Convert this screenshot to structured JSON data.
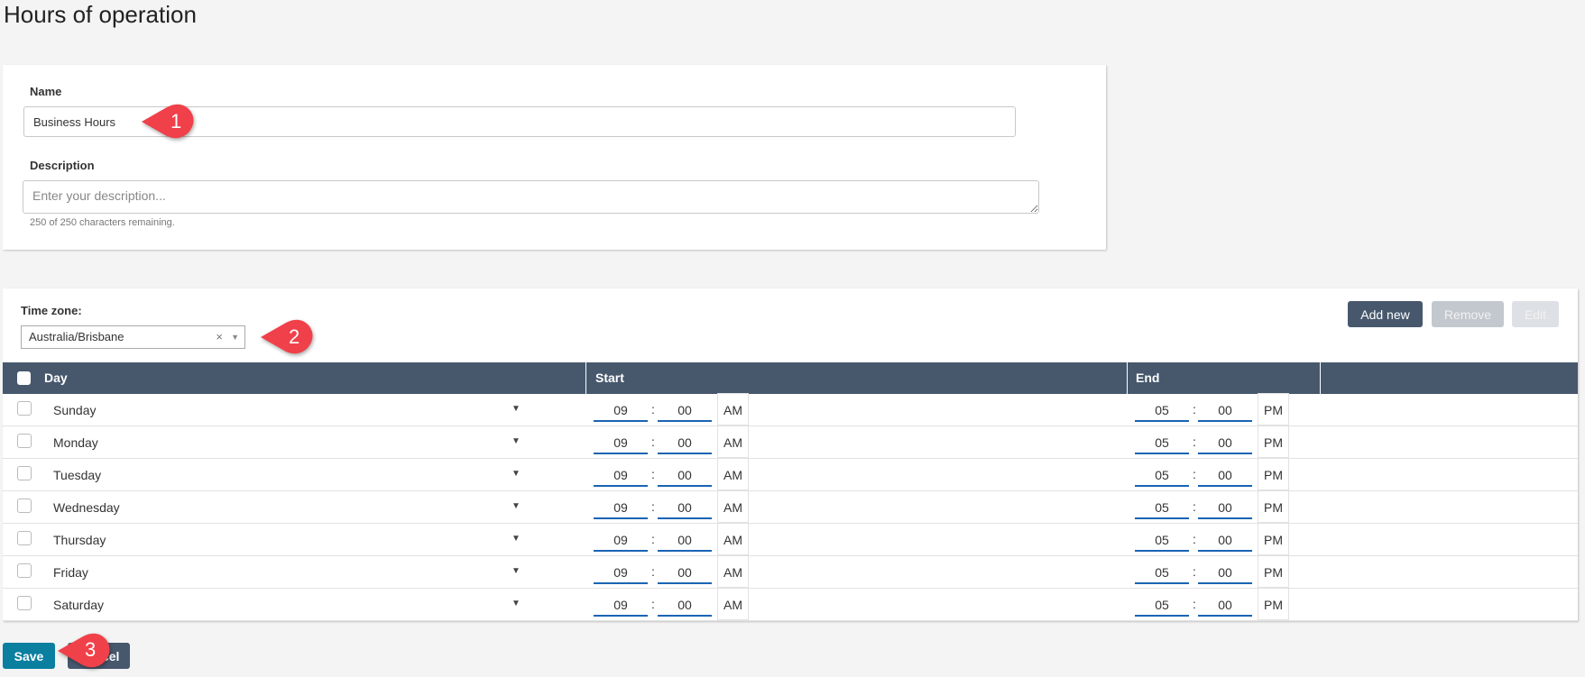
{
  "page": {
    "title": "Hours of operation"
  },
  "form": {
    "name_label": "Name",
    "name_value": "Business Hours",
    "description_label": "Description",
    "description_placeholder": "Enter your description...",
    "description_value": "",
    "char_hint": "250 of 250 characters remaining."
  },
  "timezone": {
    "label": "Time zone:",
    "value": "Australia/Brisbane",
    "clear_glyph": "×",
    "arrow_glyph": "▼"
  },
  "toolbar": {
    "add_label": "Add new",
    "remove_label": "Remove",
    "edit_label": "Edit"
  },
  "table": {
    "headers": {
      "day": "Day",
      "start": "Start",
      "end": "End"
    },
    "rows": [
      {
        "day": "Sunday",
        "start_h": "09",
        "start_m": "00",
        "start_ampm": "AM",
        "end_h": "05",
        "end_m": "00",
        "end_ampm": "PM"
      },
      {
        "day": "Monday",
        "start_h": "09",
        "start_m": "00",
        "start_ampm": "AM",
        "end_h": "05",
        "end_m": "00",
        "end_ampm": "PM"
      },
      {
        "day": "Tuesday",
        "start_h": "09",
        "start_m": "00",
        "start_ampm": "AM",
        "end_h": "05",
        "end_m": "00",
        "end_ampm": "PM"
      },
      {
        "day": "Wednesday",
        "start_h": "09",
        "start_m": "00",
        "start_ampm": "AM",
        "end_h": "05",
        "end_m": "00",
        "end_ampm": "PM"
      },
      {
        "day": "Thursday",
        "start_h": "09",
        "start_m": "00",
        "start_ampm": "AM",
        "end_h": "05",
        "end_m": "00",
        "end_ampm": "PM"
      },
      {
        "day": "Friday",
        "start_h": "09",
        "start_m": "00",
        "start_ampm": "AM",
        "end_h": "05",
        "end_m": "00",
        "end_ampm": "PM"
      },
      {
        "day": "Saturday",
        "start_h": "09",
        "start_m": "00",
        "start_ampm": "AM",
        "end_h": "05",
        "end_m": "00",
        "end_ampm": "PM"
      }
    ],
    "colon": ":",
    "dropdown_glyph": "▼"
  },
  "footer": {
    "save_label": "Save",
    "cancel_label": "Cancel"
  },
  "annotations": {
    "callout_1": "1",
    "callout_2": "2",
    "callout_3": "3",
    "callout_color": "#f0404a"
  },
  "colors": {
    "header_bg": "#47586d",
    "save_bg": "#0a7fa0",
    "time_underline": "#1a64b4"
  }
}
